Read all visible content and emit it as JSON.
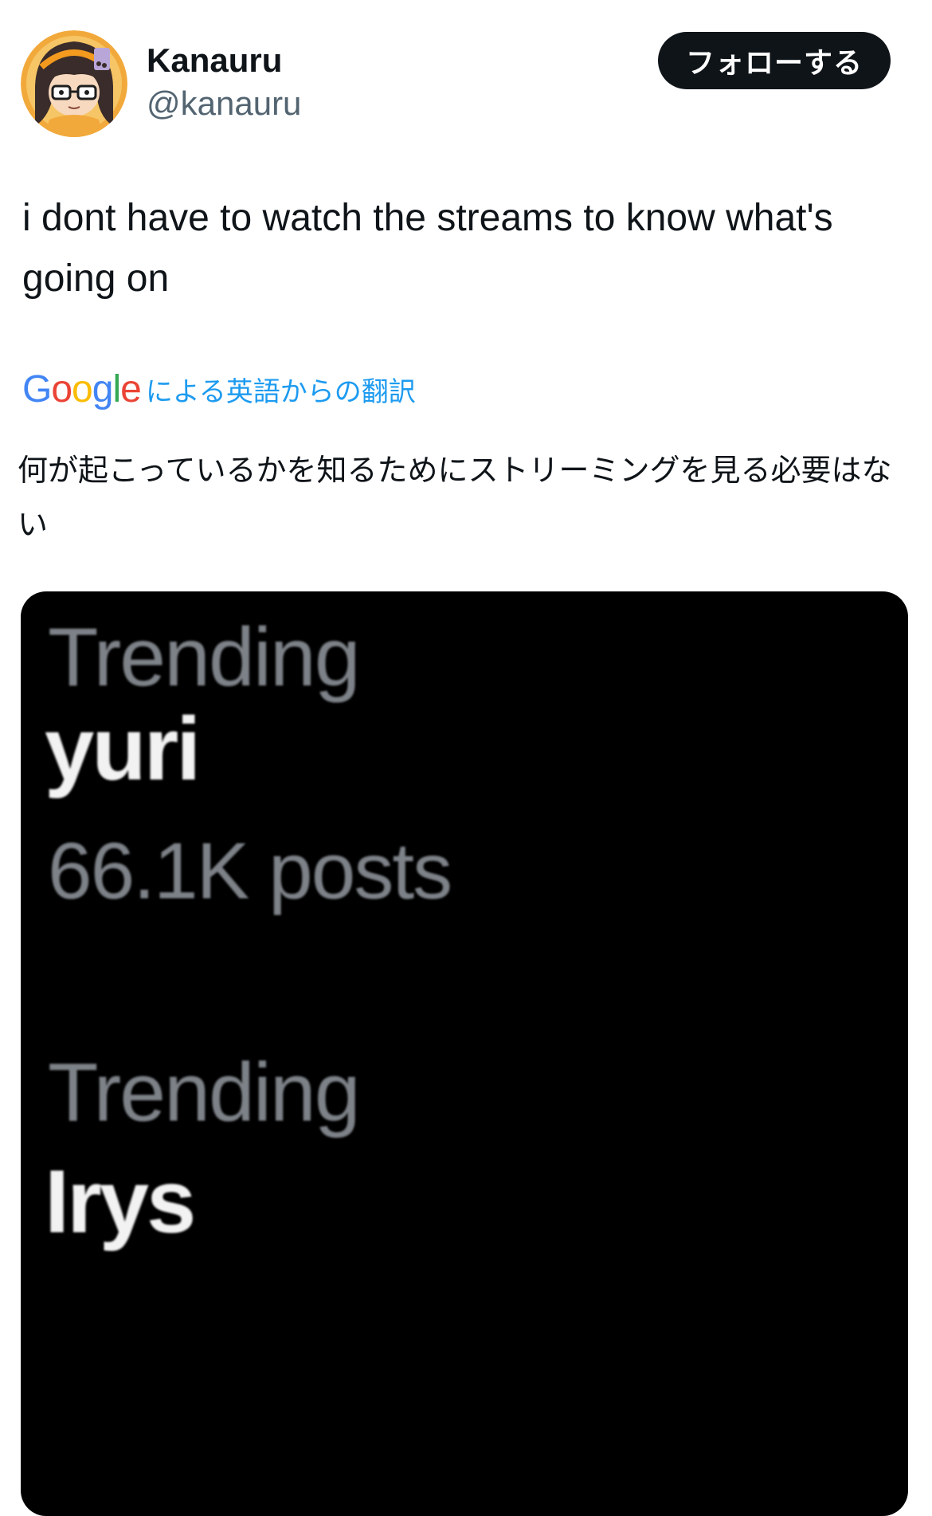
{
  "user": {
    "display_name": "Kanauru",
    "handle": "@kanauru"
  },
  "follow_button": {
    "label": "フォローする"
  },
  "tweet": {
    "text": "i dont have to watch the streams to know what's going on"
  },
  "translation": {
    "provider": "Google",
    "label": "による英語からの翻訳",
    "text": "何が起こっているかを知るためにストリーミングを見る必要はない"
  },
  "media": {
    "trends": [
      {
        "label": "Trending",
        "term": "yuri",
        "count": "66.1K posts"
      },
      {
        "label": "Trending",
        "term": "Irys"
      }
    ]
  },
  "colors": {
    "follow_bg": "#0f1419",
    "link_blue": "#1d9bf0",
    "handle_gray": "#536471",
    "media_bg": "#000000",
    "trend_gray": "#7d8288"
  }
}
